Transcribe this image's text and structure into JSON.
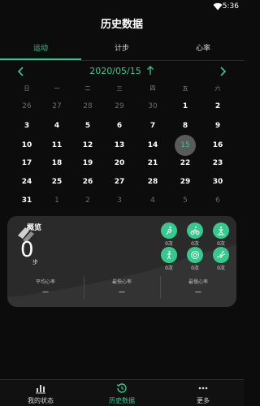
{
  "status_bar": {
    "time": "5:36"
  },
  "header": {
    "title": "历史数据"
  },
  "tabs": [
    {
      "label": "运动"
    },
    {
      "label": "计步"
    },
    {
      "label": "心率"
    }
  ],
  "calendar": {
    "month_label": "2020/05/15",
    "weekdays": [
      "日",
      "一",
      "二",
      "三",
      "四",
      "五",
      "六"
    ],
    "rows": [
      [
        {
          "d": "26",
          "m": true
        },
        {
          "d": "27",
          "m": true
        },
        {
          "d": "28",
          "m": true
        },
        {
          "d": "29",
          "m": true
        },
        {
          "d": "30",
          "m": true
        },
        {
          "d": "1"
        },
        {
          "d": "2"
        }
      ],
      [
        {
          "d": "3"
        },
        {
          "d": "4"
        },
        {
          "d": "5"
        },
        {
          "d": "6"
        },
        {
          "d": "7"
        },
        {
          "d": "8"
        },
        {
          "d": "9"
        }
      ],
      [
        {
          "d": "10"
        },
        {
          "d": "11"
        },
        {
          "d": "12"
        },
        {
          "d": "13"
        },
        {
          "d": "14"
        },
        {
          "d": "15",
          "sel": true
        },
        {
          "d": "16"
        }
      ],
      [
        {
          "d": "17"
        },
        {
          "d": "18"
        },
        {
          "d": "19"
        },
        {
          "d": "20"
        },
        {
          "d": "21"
        },
        {
          "d": "22"
        },
        {
          "d": "23"
        }
      ],
      [
        {
          "d": "24"
        },
        {
          "d": "25"
        },
        {
          "d": "26"
        },
        {
          "d": "27"
        },
        {
          "d": "28"
        },
        {
          "d": "29"
        },
        {
          "d": "30"
        }
      ],
      [
        {
          "d": "31"
        },
        {
          "d": "1",
          "m": true
        },
        {
          "d": "2",
          "m": true
        },
        {
          "d": "3",
          "m": true
        },
        {
          "d": "4",
          "m": true
        },
        {
          "d": "5",
          "m": true
        },
        {
          "d": "6",
          "m": true
        }
      ]
    ]
  },
  "overview": {
    "title": "概览",
    "count": "0",
    "unit": "步",
    "sports": [
      {
        "icon": "run-icon",
        "count": "0次"
      },
      {
        "icon": "cycling-icon",
        "count": "0次"
      },
      {
        "icon": "climb-icon",
        "count": "0次"
      },
      {
        "icon": "walk-icon",
        "count": "0次"
      },
      {
        "icon": "target-icon",
        "count": "0次"
      },
      {
        "icon": "ski-icon",
        "count": "0次"
      }
    ],
    "heart_rate": [
      {
        "label": "平均心率",
        "value": "—"
      },
      {
        "label": "最快心率",
        "value": "—"
      },
      {
        "label": "最慢心率",
        "value": "—"
      }
    ]
  },
  "bottom_nav": [
    {
      "label": "我的状态",
      "icon": "bar-chart-icon"
    },
    {
      "label": "历史数据",
      "icon": "history-icon"
    },
    {
      "label": "更多",
      "icon": "more-icon"
    }
  ],
  "colors": {
    "accent": "#35c98f",
    "background": "#0c0c0c",
    "card": "#2a2a2a"
  }
}
